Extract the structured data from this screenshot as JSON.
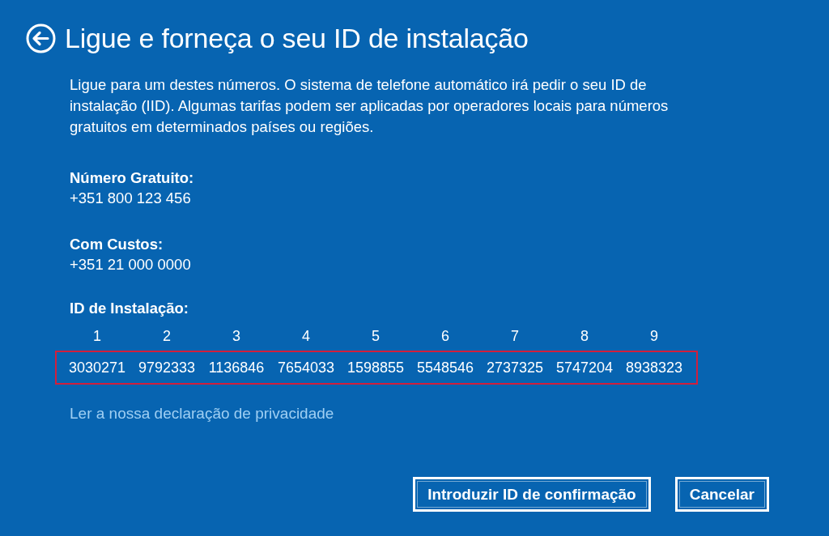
{
  "header": {
    "title": "Ligue e forneça o seu ID de instalação"
  },
  "intro": "Ligue para um destes números. O sistema de telefone automático irá pedir o seu ID de instalação (IID). Algumas tarifas podem ser aplicadas por operadores locais para números gratuitos em determinados países ou regiões.",
  "contacts": [
    {
      "label": "Número Gratuito:",
      "number": "+351 800 123 456"
    },
    {
      "label": "Com Custos:",
      "number": "+351 21 000 0000"
    }
  ],
  "installation_id": {
    "label": "ID de Instalação:",
    "columns": [
      "1",
      "2",
      "3",
      "4",
      "5",
      "6",
      "7",
      "8",
      "9"
    ],
    "groups": [
      "3030271",
      "9792333",
      "1136846",
      "7654033",
      "1598855",
      "5548546",
      "2737325",
      "5747204",
      "8938323"
    ],
    "highlighted": true
  },
  "privacy_link": "Ler a nossa declaração de privacidade",
  "buttons": [
    {
      "label": "Introduzir ID de confirmação"
    },
    {
      "label": "Cancelar"
    }
  ]
}
